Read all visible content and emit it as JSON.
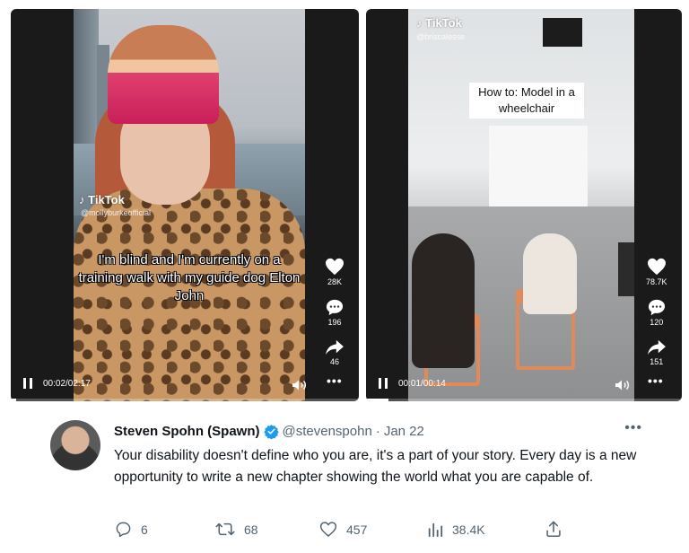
{
  "videos": [
    {
      "brand": "TikTok",
      "username": "@mollyburkeofficial",
      "caption": "I'm blind and I'm currently on a training walk with my guide dog Elton John",
      "likes": "28K",
      "comments": "196",
      "shares": "46",
      "time": "00:02/02:17",
      "progress": 0.015
    },
    {
      "brand": "TikTok",
      "username": "@briscalesse",
      "caption": "How to: Model in a wheelchair",
      "likes": "78.7K",
      "comments": "120",
      "shares": "151",
      "time": "00:01/00:14",
      "progress": 0.07
    }
  ],
  "tweet": {
    "name": "Steven Spohn (Spawn)",
    "handle": "@stevenspohn",
    "separator": "·",
    "date": "Jan 22",
    "text": "Your disability doesn't define who you are, it's a part of your story. Every day is a new opportunity to write a new chapter showing the world what you are capable of.",
    "replies": "6",
    "retweets": "68",
    "likes": "457",
    "views": "38.4K"
  },
  "colors": {
    "verified": "#1d9bf0",
    "muted": "#536471",
    "text": "#0f1419"
  }
}
